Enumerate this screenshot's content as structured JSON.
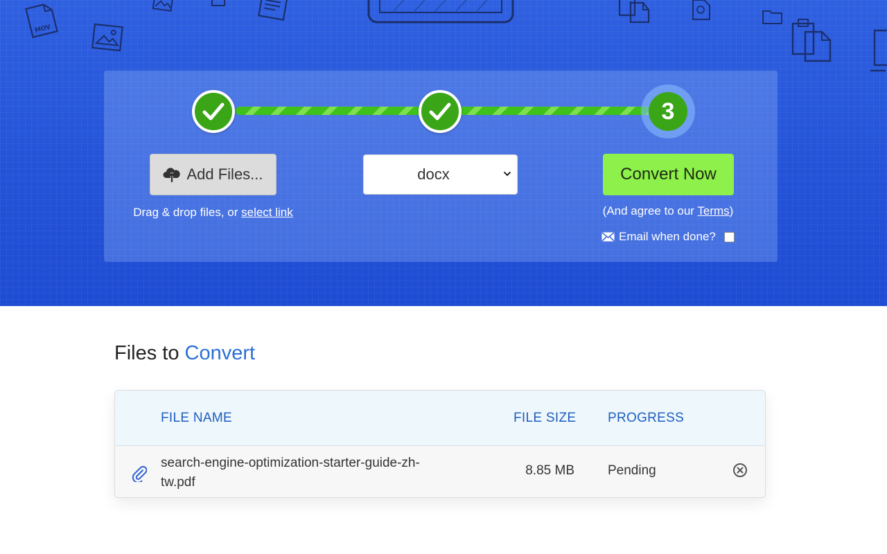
{
  "steps": {
    "step1_state": "done",
    "step2_state": "done",
    "step3_number": "3"
  },
  "upload": {
    "add_files_label": "Add Files...",
    "hint_prefix": "Drag & drop files, or ",
    "hint_link": "select link"
  },
  "format": {
    "selected": "docx"
  },
  "convert": {
    "button_label": "Convert Now",
    "agree_prefix": "(And agree to our ",
    "agree_link": "Terms",
    "agree_suffix": ")",
    "email_label": "Email when done?",
    "email_checked": false
  },
  "files_section": {
    "title_part1": "Files to ",
    "title_part2": "Convert",
    "columns": {
      "file_name": "FILE NAME",
      "file_size": "FILE SIZE",
      "progress": "PROGRESS"
    },
    "rows": [
      {
        "file_name": "search-engine-optimization-starter-guide-zh-tw.pdf",
        "file_size": "8.85 MB",
        "progress": "Pending"
      }
    ]
  },
  "icons": {
    "step_done": "checkmark-icon",
    "add_files": "cloud-upload-icon",
    "select_arrow": "chevron-down-icon",
    "email": "envelope-icon",
    "attachment": "paperclip-icon",
    "remove": "close-circle-icon"
  },
  "colors": {
    "hero_blue": "#2453d8",
    "step_green": "#3aa516",
    "convert_green": "#8ef04a",
    "accent_blue": "#2b6fd6",
    "header_text_blue": "#1e5dc0"
  }
}
